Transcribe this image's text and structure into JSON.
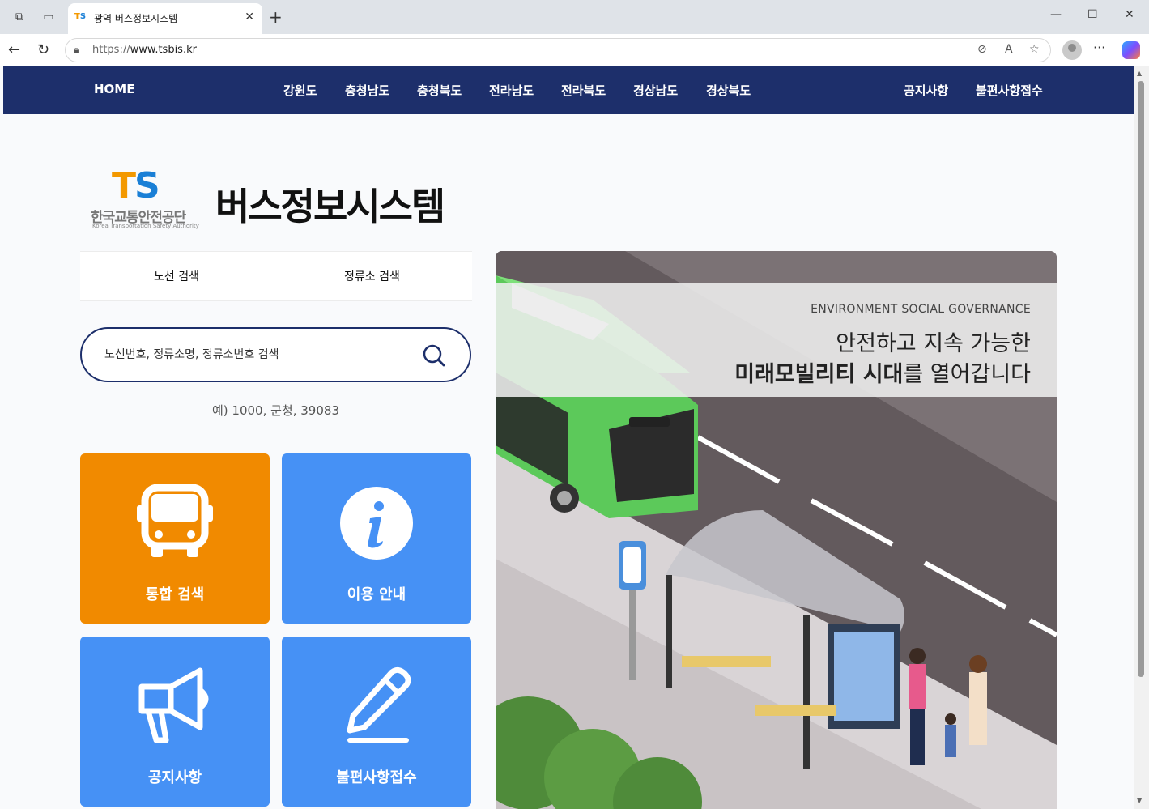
{
  "browser": {
    "tab_title": "광역 버스정보시스템",
    "tab_favicon_a": "T",
    "tab_favicon_b": "S",
    "url_prefix": "https://",
    "url_host": "www.tsbis.kr"
  },
  "nav": {
    "home": "HOME",
    "regions": [
      "강원도",
      "충청남도",
      "충청북도",
      "전라남도",
      "전라북도",
      "경상남도",
      "경상북도"
    ],
    "notice": "공지사항",
    "complaint": "불편사항접수"
  },
  "logo": {
    "mark_t": "T",
    "mark_s": "S",
    "org_kr": "한국교통안전공단",
    "org_en": "Korea Transportation Safety Authority"
  },
  "site_title": "버스정보시스템",
  "search": {
    "tab_route": "노선 검색",
    "tab_stop": "정류소 검색",
    "placeholder": "노선번호, 정류소명, 정류소번호 검색",
    "example": "예) 1000, 군청, 39083"
  },
  "tiles": {
    "integrated": {
      "label": "통합 검색",
      "color": "#f18a00",
      "icon": "bus-icon"
    },
    "guide": {
      "label": "이용 안내",
      "color": "#4691f5",
      "icon": "info-icon"
    },
    "notice": {
      "label": "공지사항",
      "color": "#4691f5",
      "icon": "megaphone-icon"
    },
    "complaint": {
      "label": "불편사항접수",
      "color": "#4691f5",
      "icon": "pencil-icon"
    }
  },
  "banner": {
    "eng": "ENVIRONMENT SOCIAL GOVERNANCE",
    "line1": "안전하고 지속 가능한",
    "line2_bold": "미래모빌리티 시대",
    "line2_rest": "를 열어갑니다"
  },
  "colors": {
    "nav_bg": "#1d2f6b",
    "accent_orange": "#f18a00",
    "accent_blue": "#4691f5"
  }
}
